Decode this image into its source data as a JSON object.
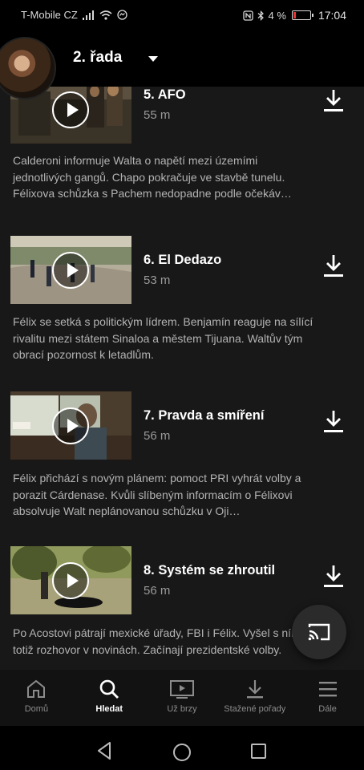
{
  "status_bar": {
    "carrier": "T-Mobile CZ",
    "battery": "4 %",
    "battery_level": 0.04,
    "time": "17:04"
  },
  "header": {
    "season_label": "2. řada"
  },
  "episodes": [
    {
      "title": "5. AFO",
      "duration": "55 m",
      "description": "Calderoni informuje Walta o napětí mezi územími jednotlivých gangů. Chapo pokračuje ve stavbě tunelu. Félixova schůzka s Pachem nedopadne podle očekáv…"
    },
    {
      "title": "6. El Dedazo",
      "duration": "53 m",
      "description": "Félix se setká s politickým lídrem. Benjamín reaguje na sílící rivalitu mezi státem Sinaloa a městem Tijuana. Waltův tým obrací pozornost k letadlům."
    },
    {
      "title": "7. Pravda a smíření",
      "duration": "56 m",
      "description": "Félix přichází s novým plánem: pomoct PRI vyhrát volby a porazit Cárdenase. Kvůli slíbeným informacím o Félixovi absolvuje Walt neplánovanou schůzku v Oji…"
    },
    {
      "title": "8. Systém se zhroutil",
      "duration": "56 m",
      "description": "Po Acostovi pátrají mexické úřady, FBI i Félix. Vyšel s ním totiž rozhovor v novinách. Začínají prezidentské volby."
    }
  ],
  "bottom_nav": [
    {
      "label": "Domů",
      "icon": "home-icon",
      "active": false
    },
    {
      "label": "Hledat",
      "icon": "search-icon",
      "active": true
    },
    {
      "label": "Už brzy",
      "icon": "coming-soon-icon",
      "active": false
    },
    {
      "label": "Stažené pořady",
      "icon": "download-icon",
      "active": false
    },
    {
      "label": "Dále",
      "icon": "menu-icon",
      "active": false
    }
  ],
  "colors": {
    "background": "#181818",
    "header": "#000000",
    "text_secondary": "#b3b3b3",
    "duration": "#9a9a9a"
  }
}
